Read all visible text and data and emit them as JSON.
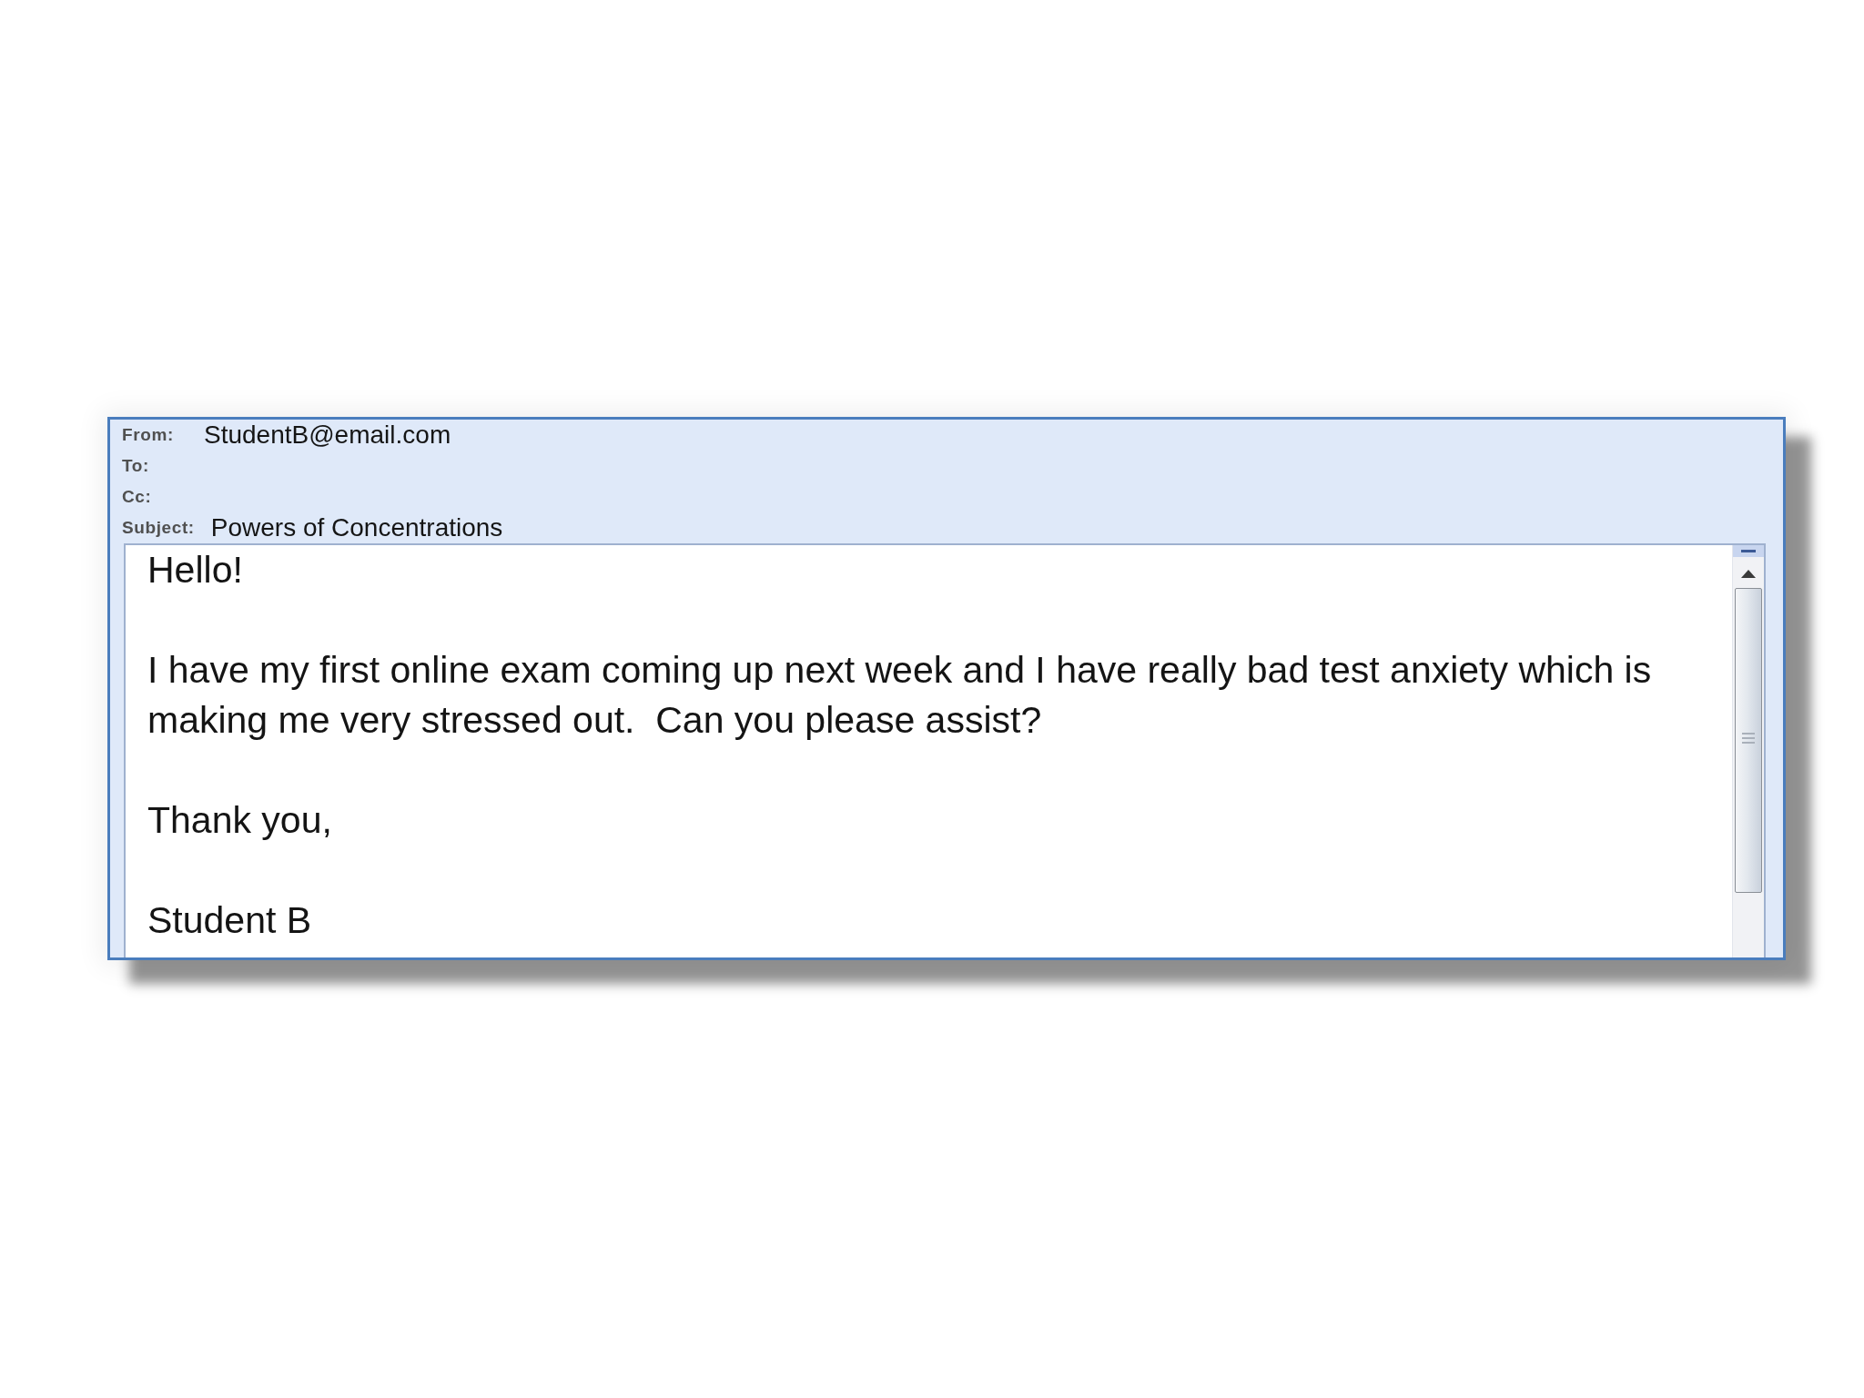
{
  "email": {
    "header_fields": [
      {
        "label": "From:",
        "value": "StudentB@email.com"
      },
      {
        "label": "To:"
      },
      {
        "label": "Cc:"
      },
      {
        "label": "Subject:",
        "value": "Powers of Concentrations"
      }
    ],
    "body": {
      "paragraphs": [
        "Hello!",
        "I have my first online exam coming up next week and I have really bad test anxiety which is making me very stressed out.  Can you please assist?",
        "Thank you,",
        "Student B"
      ]
    }
  }
}
